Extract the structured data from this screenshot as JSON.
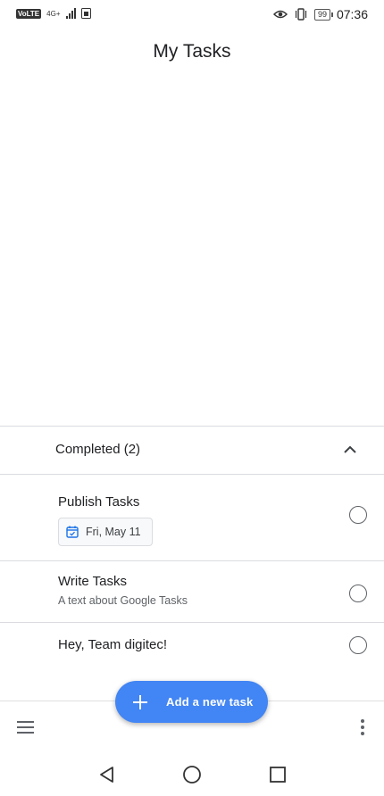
{
  "status_bar": {
    "volte": "VoLTE",
    "network": "4G+",
    "sim_icon": "sim-card-icon",
    "battery": "99",
    "time": "07:36"
  },
  "header": {
    "title": "My Tasks"
  },
  "completed_section": {
    "label": "Completed (2)",
    "expanded": true
  },
  "tasks": [
    {
      "title": "Publish Tasks",
      "date_chip": "Fri, May 11",
      "subtitle": ""
    },
    {
      "title": "Write Tasks",
      "subtitle": "A text about Google Tasks"
    },
    {
      "title": "Hey, Team digitec!",
      "subtitle": ""
    }
  ],
  "fab": {
    "label": "Add a new task",
    "icon": "plus-icon"
  },
  "bottom_bar": {
    "left_icon": "menu-icon",
    "right_icon": "more-vert-icon"
  },
  "system_nav": {
    "back": "back-triangle-icon",
    "home": "home-circle-icon",
    "recents": "recents-square-icon"
  },
  "colors": {
    "accent": "#4285f4",
    "divider": "#dadce0",
    "text": "#202124",
    "secondary_text": "#5f6368"
  }
}
